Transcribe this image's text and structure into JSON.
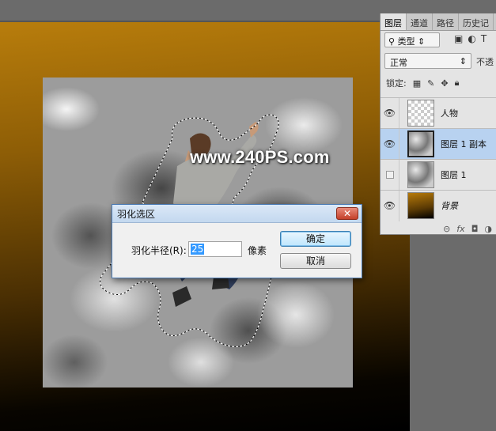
{
  "watermark": "www.240PS.com",
  "layers_panel": {
    "tabs": [
      "图层",
      "通道",
      "路径",
      "历史记"
    ],
    "filter": "类型",
    "blend_mode": "正常",
    "opacity_label": "不透",
    "lock_label": "锁定:",
    "layers": [
      {
        "name": "人物",
        "visible": true,
        "selected": false,
        "italic": false
      },
      {
        "name": "图层 1 副本",
        "visible": true,
        "selected": true,
        "italic": false
      },
      {
        "name": "图层 1",
        "visible": false,
        "selected": false,
        "italic": false
      },
      {
        "name": "背景",
        "visible": true,
        "selected": false,
        "italic": true
      }
    ]
  },
  "dialog": {
    "title": "羽化选区",
    "close": "✕",
    "radius_label": "羽化半径(R):",
    "radius_value": "25",
    "unit": "像素",
    "ok": "确定",
    "cancel": "取消"
  },
  "colors": {
    "accent": "#3399ff",
    "selected_layer": "#b8d2f0",
    "dialog_border": "#4a7ab4"
  }
}
